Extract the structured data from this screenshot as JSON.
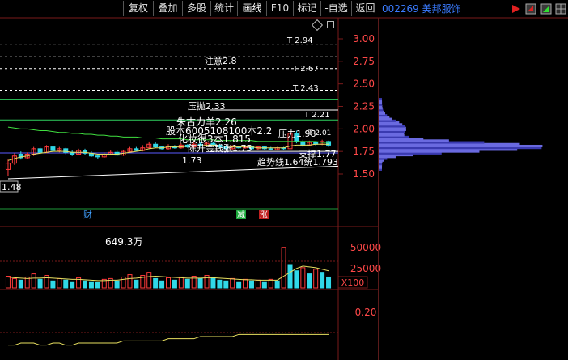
{
  "toolbar": {
    "buttons": [
      {
        "id": "fuquan",
        "label": "复权"
      },
      {
        "id": "diejia",
        "label": "叠加"
      },
      {
        "id": "duogu",
        "label": "多股"
      },
      {
        "id": "tongji",
        "label": "统计"
      },
      {
        "id": "huaxian",
        "label": "画线"
      },
      {
        "id": "f10",
        "label": "F10"
      },
      {
        "id": "biaoji",
        "label": "标记"
      },
      {
        "id": "zixuan",
        "label": "-自选"
      },
      {
        "id": "fanhui",
        "label": "返回"
      }
    ],
    "stock_title": "002269 美邦服饰"
  },
  "colors": {
    "background": "#000000",
    "rise": "#ff3b3b",
    "fall": "#30d8e8",
    "axis": "#7a1a1a",
    "text_axis": "#ff4848",
    "dashed": "#ffffff",
    "ma_yellow": "#e8e060",
    "ma_green": "#40e040",
    "ma_blue": "#5a5aff"
  },
  "price_axis": {
    "ticks": [
      "3.00",
      "2.75",
      "2.50",
      "2.25",
      "2.00",
      "1.75",
      "1.50"
    ]
  },
  "volume_axis": {
    "ticks": [
      "50000",
      "25000"
    ],
    "unit": "X100"
  },
  "indicator_axis": {
    "ticks": [
      "0.20"
    ]
  },
  "annotations": {
    "t294": "T 2.94",
    "notice28": "注意2.8",
    "t267": "T 2.67",
    "t243": "T 2.43",
    "yaji233": "压抛2.33",
    "t221": "T 2.21",
    "zhuqi": "朱古力羊2.26",
    "guben": "股本6005108100本2.2",
    "pressure": "压力1.98",
    "t201": "T 2.01",
    "huaming": "化妆很3本1.815",
    "chenyin": "陈升金钱张1.75",
    "support": "支撑1.77",
    "low173": "1.73",
    "trend": "趋势线1.64统1.793",
    "low148": "1.48",
    "cai": "财",
    "jian": "减",
    "zhang": "涨",
    "vol_label": "649.3万"
  },
  "chart_data": [
    {
      "type": "candlestick",
      "ylim": [
        1.4,
        3.1
      ],
      "price_ticks": [
        3.0,
        2.75,
        2.5,
        2.25,
        2.0,
        1.75,
        1.5
      ],
      "horizontal_levels": [
        2.94,
        2.8,
        2.67,
        2.43,
        2.33,
        2.21,
        1.75
      ],
      "candles": [
        {
          "o": 1.55,
          "c": 1.62,
          "h": 1.66,
          "l": 1.48
        },
        {
          "o": 1.62,
          "c": 1.7,
          "h": 1.73,
          "l": 1.6
        },
        {
          "o": 1.72,
          "c": 1.68,
          "h": 1.75,
          "l": 1.66
        },
        {
          "o": 1.68,
          "c": 1.72,
          "h": 1.74,
          "l": 1.67
        },
        {
          "o": 1.72,
          "c": 1.78,
          "h": 1.8,
          "l": 1.7
        },
        {
          "o": 1.78,
          "c": 1.74,
          "h": 1.8,
          "l": 1.72
        },
        {
          "o": 1.74,
          "c": 1.8,
          "h": 1.82,
          "l": 1.73
        },
        {
          "o": 1.8,
          "c": 1.76,
          "h": 1.81,
          "l": 1.74
        },
        {
          "o": 1.76,
          "c": 1.78,
          "h": 1.8,
          "l": 1.74
        },
        {
          "o": 1.78,
          "c": 1.74,
          "h": 1.79,
          "l": 1.72
        },
        {
          "o": 1.74,
          "c": 1.72,
          "h": 1.76,
          "l": 1.7
        },
        {
          "o": 1.72,
          "c": 1.76,
          "h": 1.78,
          "l": 1.71
        },
        {
          "o": 1.76,
          "c": 1.73,
          "h": 1.78,
          "l": 1.71
        },
        {
          "o": 1.73,
          "c": 1.7,
          "h": 1.75,
          "l": 1.69
        },
        {
          "o": 1.7,
          "c": 1.69,
          "h": 1.72,
          "l": 1.67
        },
        {
          "o": 1.69,
          "c": 1.72,
          "h": 1.74,
          "l": 1.68
        },
        {
          "o": 1.72,
          "c": 1.74,
          "h": 1.76,
          "l": 1.71
        },
        {
          "o": 1.74,
          "c": 1.71,
          "h": 1.76,
          "l": 1.7
        },
        {
          "o": 1.71,
          "c": 1.75,
          "h": 1.77,
          "l": 1.7
        },
        {
          "o": 1.75,
          "c": 1.78,
          "h": 1.8,
          "l": 1.74
        },
        {
          "o": 1.78,
          "c": 1.76,
          "h": 1.8,
          "l": 1.75
        },
        {
          "o": 1.76,
          "c": 1.79,
          "h": 1.82,
          "l": 1.75
        },
        {
          "o": 1.79,
          "c": 1.83,
          "h": 1.86,
          "l": 1.78
        },
        {
          "o": 1.83,
          "c": 1.8,
          "h": 1.85,
          "l": 1.79
        },
        {
          "o": 1.8,
          "c": 1.78,
          "h": 1.81,
          "l": 1.77
        },
        {
          "o": 1.78,
          "c": 1.81,
          "h": 1.83,
          "l": 1.77
        },
        {
          "o": 1.81,
          "c": 1.79,
          "h": 1.82,
          "l": 1.78
        },
        {
          "o": 1.79,
          "c": 1.82,
          "h": 1.84,
          "l": 1.78
        },
        {
          "o": 1.82,
          "c": 1.8,
          "h": 1.83,
          "l": 1.79
        },
        {
          "o": 1.8,
          "c": 1.83,
          "h": 1.85,
          "l": 1.79
        },
        {
          "o": 1.83,
          "c": 1.81,
          "h": 1.85,
          "l": 1.8
        },
        {
          "o": 1.81,
          "c": 1.84,
          "h": 1.86,
          "l": 1.8
        },
        {
          "o": 1.84,
          "c": 1.82,
          "h": 1.86,
          "l": 1.81
        },
        {
          "o": 1.82,
          "c": 1.8,
          "h": 1.83,
          "l": 1.78
        },
        {
          "o": 1.8,
          "c": 1.78,
          "h": 1.81,
          "l": 1.77
        },
        {
          "o": 1.78,
          "c": 1.8,
          "h": 1.82,
          "l": 1.77
        },
        {
          "o": 1.8,
          "c": 1.79,
          "h": 1.81,
          "l": 1.78
        },
        {
          "o": 1.79,
          "c": 1.81,
          "h": 1.82,
          "l": 1.78
        },
        {
          "o": 1.81,
          "c": 1.78,
          "h": 1.82,
          "l": 1.77
        },
        {
          "o": 1.78,
          "c": 1.8,
          "h": 1.81,
          "l": 1.76
        },
        {
          "o": 1.8,
          "c": 1.78,
          "h": 1.81,
          "l": 1.77
        },
        {
          "o": 1.78,
          "c": 1.77,
          "h": 1.8,
          "l": 1.76
        },
        {
          "o": 1.77,
          "c": 1.79,
          "h": 1.8,
          "l": 1.76
        },
        {
          "o": 1.79,
          "c": 1.78,
          "h": 1.8,
          "l": 1.77
        },
        {
          "o": 1.78,
          "c": 1.95,
          "h": 1.98,
          "l": 1.77
        },
        {
          "o": 1.95,
          "c": 1.86,
          "h": 1.98,
          "l": 1.84
        },
        {
          "o": 1.86,
          "c": 1.82,
          "h": 1.88,
          "l": 1.8
        },
        {
          "o": 1.82,
          "c": 1.85,
          "h": 1.87,
          "l": 1.81
        },
        {
          "o": 1.85,
          "c": 1.83,
          "h": 1.86,
          "l": 1.81
        },
        {
          "o": 1.83,
          "c": 1.86,
          "h": 1.88,
          "l": 1.82
        },
        {
          "o": 1.86,
          "c": 1.82,
          "h": 1.87,
          "l": 1.8
        }
      ],
      "ma_slow": [
        2.02,
        2.01,
        2.0,
        2.0,
        1.99,
        1.98,
        1.98,
        1.97,
        1.96,
        1.96,
        1.95,
        1.95,
        1.94,
        1.94,
        1.93,
        1.93,
        1.92,
        1.92,
        1.91,
        1.91,
        1.91,
        1.9,
        1.9,
        1.9,
        1.89,
        1.89,
        1.89,
        1.89,
        1.88,
        1.88,
        1.88,
        1.88,
        1.88,
        1.87,
        1.87,
        1.87,
        1.87,
        1.87,
        1.87,
        1.86,
        1.86,
        1.86,
        1.86,
        1.86,
        1.86,
        1.86,
        1.86,
        1.86,
        1.86,
        1.85,
        1.85
      ],
      "ma_mid": [
        1.65,
        1.67,
        1.69,
        1.7,
        1.72,
        1.73,
        1.74,
        1.75,
        1.75,
        1.75,
        1.74,
        1.74,
        1.74,
        1.73,
        1.72,
        1.72,
        1.72,
        1.72,
        1.73,
        1.74,
        1.75,
        1.76,
        1.78,
        1.79,
        1.79,
        1.8,
        1.8,
        1.8,
        1.81,
        1.81,
        1.81,
        1.82,
        1.82,
        1.81,
        1.81,
        1.8,
        1.8,
        1.8,
        1.8,
        1.79,
        1.79,
        1.79,
        1.79,
        1.79,
        1.81,
        1.82,
        1.82,
        1.82,
        1.83,
        1.83,
        1.83
      ],
      "trend_line": [
        1.5,
        1.64
      ],
      "support_level": 1.77
    },
    {
      "type": "bar",
      "name": "volume",
      "ylim": [
        0,
        60000
      ],
      "values": [
        15000,
        12000,
        10000,
        14000,
        18000,
        11000,
        16000,
        9000,
        12000,
        10000,
        8000,
        13000,
        9000,
        8000,
        7000,
        11000,
        12000,
        9000,
        14000,
        17000,
        10000,
        16000,
        20000,
        12000,
        9000,
        13000,
        10000,
        14000,
        11000,
        15000,
        12000,
        16000,
        13000,
        10000,
        9000,
        12000,
        8000,
        11000,
        9000,
        10000,
        8000,
        11000,
        9000,
        52000,
        30000,
        22000,
        26000,
        18000,
        24000,
        20000,
        14000
      ],
      "up": [
        true,
        true,
        false,
        true,
        true,
        false,
        true,
        false,
        true,
        false,
        false,
        true,
        false,
        false,
        false,
        true,
        true,
        false,
        true,
        true,
        false,
        true,
        true,
        false,
        false,
        true,
        false,
        true,
        false,
        true,
        false,
        true,
        false,
        false,
        false,
        true,
        false,
        true,
        false,
        true,
        false,
        true,
        false,
        true,
        false,
        false,
        true,
        false,
        true,
        false,
        false
      ],
      "ma": [
        14000,
        13000,
        12500,
        12000,
        12500,
        12500,
        13000,
        12500,
        12000,
        11500,
        11000,
        11000,
        10500,
        10000,
        9500,
        9500,
        10000,
        10000,
        11000,
        12000,
        12500,
        13500,
        14500,
        15000,
        14500,
        14000,
        13500,
        13000,
        12500,
        12500,
        12500,
        13000,
        13000,
        12500,
        12000,
        11500,
        11000,
        10500,
        10500,
        10000,
        10000,
        10000,
        10000,
        15000,
        20000,
        25000,
        28000,
        27000,
        26000,
        24000,
        22000
      ]
    },
    {
      "type": "line",
      "name": "indicator",
      "ylim": [
        0.0,
        0.3
      ],
      "values": [
        0.05,
        0.05,
        0.06,
        0.06,
        0.06,
        0.05,
        0.05,
        0.06,
        0.06,
        0.05,
        0.05,
        0.06,
        0.06,
        0.06,
        0.06,
        0.06,
        0.06,
        0.06,
        0.07,
        0.07,
        0.07,
        0.07,
        0.07,
        0.07,
        0.07,
        0.08,
        0.08,
        0.08,
        0.08,
        0.08,
        0.09,
        0.09,
        0.09,
        0.09,
        0.09,
        0.09,
        0.1,
        0.1,
        0.1,
        0.1,
        0.1,
        0.1,
        0.1,
        0.1,
        0.1,
        0.1,
        0.1,
        0.1,
        0.1,
        0.1,
        0.1
      ]
    }
  ]
}
